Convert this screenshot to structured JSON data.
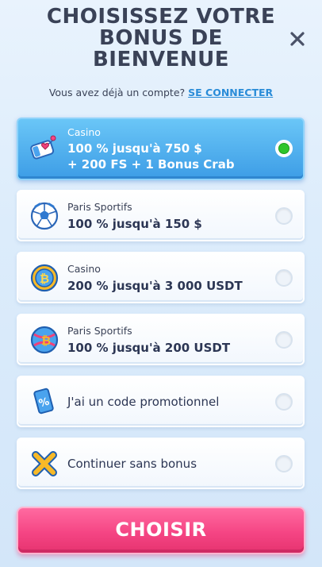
{
  "header": {
    "title_line1": "CHOISISSEZ VOTRE",
    "title_line2": "BONUS DE",
    "title_line3": "BIENVENUE",
    "close_icon": "close-icon"
  },
  "login": {
    "prompt": "Vous avez déjà un compte?",
    "link_label": "SE CONNECTER"
  },
  "options": [
    {
      "category": "Casino",
      "line1": "100 % jusqu'à 750 $",
      "line2": "+ 200 FS + 1 Bonus Crab",
      "icon": "ticket-heart-icon",
      "selected": true
    },
    {
      "category": "Paris Sportifs",
      "line1": "100 % jusqu'à 150 $",
      "icon": "soccer-ball-icon",
      "selected": false
    },
    {
      "category": "Casino",
      "line1": "200 % jusqu'à 3 000 USDT",
      "icon": "bitcoin-coin-icon",
      "selected": false
    },
    {
      "category": "Paris Sportifs",
      "line1": "100 % jusqu'à 200 USDT",
      "icon": "bitcoin-ball-icon",
      "selected": false
    },
    {
      "label": "J'ai un code promotionnel",
      "icon": "percent-ticket-icon",
      "selected": false
    },
    {
      "label": "Continuer sans bonus",
      "icon": "x-mark-icon",
      "selected": false
    }
  ],
  "cta": {
    "label": "CHOISIR"
  },
  "colors": {
    "selected_bg": "#3d9de6",
    "radio_selected": "#2fc52a",
    "cta_bg": "#f54584",
    "link": "#2a8cd8"
  }
}
